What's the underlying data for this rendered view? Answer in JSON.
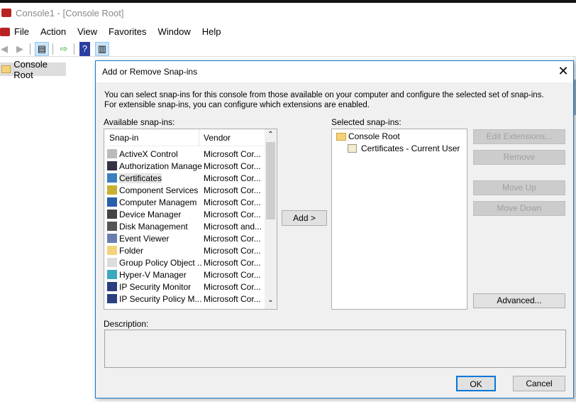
{
  "window": {
    "title": "Console1 - [Console Root]"
  },
  "menu": [
    "File",
    "Action",
    "View",
    "Favorites",
    "Window",
    "Help"
  ],
  "toolbar": {
    "icons": [
      "back-arrow-icon",
      "forward-arrow-icon",
      "show-hide-tree-icon",
      "export-list-icon",
      "help-icon",
      "show-hide-action-pane-icon"
    ]
  },
  "tree": {
    "root": "Console Root"
  },
  "dialog": {
    "title": "Add or Remove Snap-ins",
    "intro": "You can select snap-ins for this console from those available on your computer and configure the selected set of snap-ins. For extensible snap-ins, you can configure which extensions are enabled.",
    "available_label": "Available snap-ins:",
    "columns": {
      "snapin": "Snap-in",
      "vendor": "Vendor"
    },
    "available": [
      {
        "name": "ActiveX Control",
        "vendor": "Microsoft Cor...",
        "icon": "activex-icon",
        "color": "#bbb"
      },
      {
        "name": "Authorization Manager",
        "vendor": "Microsoft Cor...",
        "icon": "authorization-icon",
        "color": "#334"
      },
      {
        "name": "Certificates",
        "vendor": "Microsoft Cor...",
        "icon": "certificate-icon",
        "color": "#3a7fc0"
      },
      {
        "name": "Component Services",
        "vendor": "Microsoft Cor...",
        "icon": "component-services-icon",
        "color": "#c9b030"
      },
      {
        "name": "Computer Managem",
        "vendor": "Microsoft Cor...",
        "icon": "computer-management-icon",
        "color": "#2a5fb0"
      },
      {
        "name": "Device Manager",
        "vendor": "Microsoft Cor...",
        "icon": "device-manager-icon",
        "color": "#444"
      },
      {
        "name": "Disk Management",
        "vendor": "Microsoft and...",
        "icon": "disk-icon",
        "color": "#555"
      },
      {
        "name": "Event Viewer",
        "vendor": "Microsoft Cor...",
        "icon": "event-viewer-icon",
        "color": "#6a7fb0"
      },
      {
        "name": "Folder",
        "vendor": "Microsoft Cor...",
        "icon": "folder-icon",
        "color": "#f3d27a"
      },
      {
        "name": "Group Policy Object ...",
        "vendor": "Microsoft Cor...",
        "icon": "group-policy-icon",
        "color": "#ddd"
      },
      {
        "name": "Hyper-V Manager",
        "vendor": "Microsoft Cor...",
        "icon": "hyper-v-icon",
        "color": "#3aa8c0"
      },
      {
        "name": "IP Security Monitor",
        "vendor": "Microsoft Cor...",
        "icon": "ip-security-icon",
        "color": "#2a3f80"
      },
      {
        "name": "IP Security Policy M...",
        "vendor": "Microsoft Cor...",
        "icon": "ip-security-policy-icon",
        "color": "#2a3f80"
      }
    ],
    "selected_row": "Certificates",
    "add_button": "Add >",
    "selected_label": "Selected snap-ins:",
    "selected": {
      "root": "Console Root",
      "child": "Certificates - Current User"
    },
    "buttons": {
      "edit_extensions": "Edit Extensions...",
      "remove": "Remove",
      "move_up": "Move Up",
      "move_down": "Move Down",
      "advanced": "Advanced...",
      "ok": "OK",
      "cancel": "Cancel"
    },
    "description_label": "Description:",
    "description": ""
  }
}
